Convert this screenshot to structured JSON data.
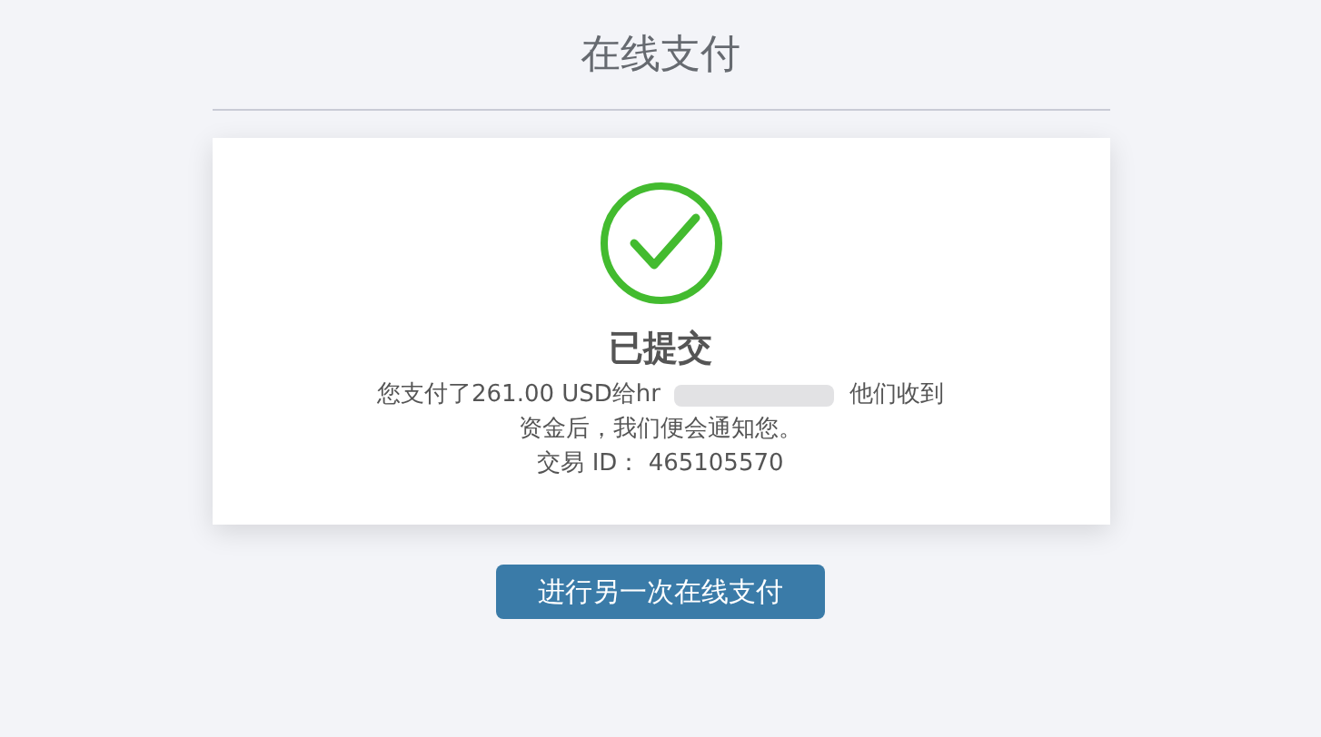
{
  "title": "在线支付",
  "status": {
    "heading": "已提交",
    "message_start": "您支付了261.00 USD给hr",
    "message_redacted": true,
    "message_end": "他们收到",
    "message_line2": "资金后，我们便会通知您。",
    "transaction": "交易 ID： 465105570"
  },
  "button": {
    "label": "进行另一次在线支付"
  }
}
